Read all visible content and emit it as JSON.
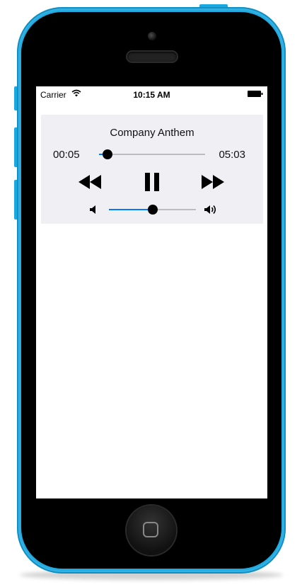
{
  "status_bar": {
    "carrier": "Carrier",
    "time": "10:15 AM",
    "icons": [
      "wifi-icon",
      "battery-icon"
    ]
  },
  "player": {
    "title": "Company Anthem",
    "elapsed": "00:05",
    "duration": "05:03",
    "progress_fraction": 0.08,
    "volume_fraction": 0.5,
    "controls": [
      "rewind-icon",
      "pause-icon",
      "fast-forward-icon"
    ],
    "volume_icons": [
      "volume-low-icon",
      "volume-high-icon"
    ]
  },
  "colors": {
    "device": "#1aa8e0",
    "accent": "#007aff",
    "player_bg": "#efeff4"
  }
}
